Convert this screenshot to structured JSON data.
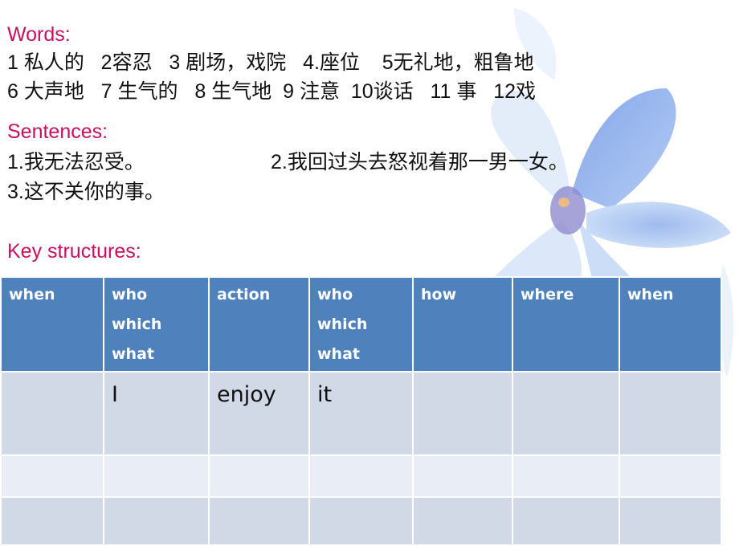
{
  "colors": {
    "heading": "#c8105f",
    "table_header": "#4f81bd",
    "row_band_dark": "#cfd7e6",
    "row_band_light": "#e8ecf4"
  },
  "background_image": "blue-orchid-flower",
  "words": {
    "title": "Words:",
    "line1": "1 私人的   2容忍   3 剧场，戏院   4.座位    5无礼地，粗鲁地",
    "line2": "6 大声地   7 生气的   8 生气地  9 注意  10谈话   11 事   12戏",
    "items": [
      {
        "num": "1",
        "text": "私人的"
      },
      {
        "num": "2",
        "text": "容忍"
      },
      {
        "num": "3",
        "text": "剧场，戏院"
      },
      {
        "num": "4",
        "text": "座位"
      },
      {
        "num": "5",
        "text": "无礼地，粗鲁地"
      },
      {
        "num": "6",
        "text": "大声地"
      },
      {
        "num": "7",
        "text": "生气的"
      },
      {
        "num": "8",
        "text": "生气地"
      },
      {
        "num": "9",
        "text": "注意"
      },
      {
        "num": "10",
        "text": "谈话"
      },
      {
        "num": "11",
        "text": "事"
      },
      {
        "num": "12",
        "text": "戏"
      }
    ]
  },
  "sentences": {
    "title": "Sentences:",
    "items": [
      "1.我无法忍受。",
      "2.我回过头去怒视着那一男一女。",
      "3.这不关你的事。"
    ]
  },
  "key_structures": {
    "title": "Key structures:",
    "headers": [
      [
        "when"
      ],
      [
        "who",
        "which",
        "what"
      ],
      [
        "action"
      ],
      [
        "who",
        "which",
        "what"
      ],
      [
        "how"
      ],
      [
        "where"
      ],
      [
        "when"
      ]
    ],
    "rows": [
      [
        "",
        "I",
        "enjoy",
        "it",
        "",
        "",
        ""
      ],
      [
        "",
        "",
        "",
        "",
        "",
        "",
        ""
      ],
      [
        "",
        "",
        "",
        "",
        "",
        "",
        ""
      ]
    ]
  }
}
